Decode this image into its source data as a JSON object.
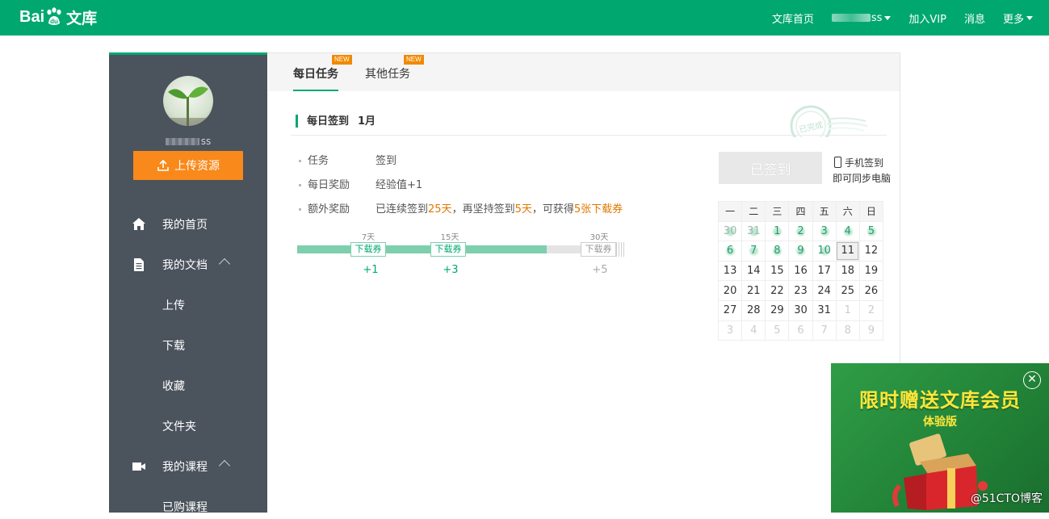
{
  "topbar": {
    "logo_text_en": "Bai",
    "logo_text_du": "du",
    "logo_text_cn": "文库",
    "nav": [
      {
        "label": "文库首页"
      },
      {
        "label": "ss"
      },
      {
        "label": "加入VIP"
      },
      {
        "label": "消息"
      },
      {
        "label": "更多"
      }
    ],
    "accent": "#00a870"
  },
  "sidebar": {
    "username_suffix": "ss",
    "upload_label": "上传资源",
    "items": [
      {
        "label": "我的首页"
      },
      {
        "label": "我的文档"
      },
      {
        "label": "上传"
      },
      {
        "label": "下载"
      },
      {
        "label": "收藏"
      },
      {
        "label": "文件夹"
      },
      {
        "label": "我的课程"
      },
      {
        "label": "已购课程"
      }
    ]
  },
  "tabs": [
    {
      "label": "每日任务",
      "badge": "NEW"
    },
    {
      "label": "其他任务",
      "badge": "NEW"
    }
  ],
  "section": {
    "title": "每日签到",
    "month": "1月",
    "stamp_text": "已完成"
  },
  "task": {
    "rows": [
      {
        "key": "任务",
        "value": "签到"
      },
      {
        "key": "每日奖励",
        "value": "经验值+1"
      },
      {
        "key": "额外奖励",
        "value_parts": [
          "已连续签到",
          "25天",
          "，再坚持签到",
          "5天",
          "，可获得",
          "5张下载券"
        ]
      }
    ],
    "progress": {
      "fill_fraction": 0.76,
      "milestones": [
        {
          "day": "7天",
          "coupon": "下载券",
          "plus": "+1"
        },
        {
          "day": "15天",
          "coupon": "下载券",
          "plus": "+3"
        },
        {
          "day": "30天",
          "coupon": "下载券",
          "plus": "+5"
        }
      ]
    }
  },
  "sign": {
    "button_label": "已签到",
    "mobile_line1": "手机签到",
    "mobile_line2": "即可同步电脑"
  },
  "calendar": {
    "weekdays": [
      "一",
      "二",
      "三",
      "四",
      "五",
      "六",
      "日"
    ],
    "weeks": [
      [
        "30",
        "31",
        "1",
        "2",
        "3",
        "4",
        "5"
      ],
      [
        "6",
        "7",
        "8",
        "9",
        "10",
        "11",
        "12"
      ],
      [
        "13",
        "14",
        "15",
        "16",
        "17",
        "18",
        "19"
      ],
      [
        "20",
        "21",
        "22",
        "23",
        "24",
        "25",
        "26"
      ],
      [
        "27",
        "28",
        "29",
        "30",
        "31",
        "1",
        "2"
      ],
      [
        "3",
        "4",
        "5",
        "6",
        "7",
        "8",
        "9"
      ]
    ],
    "today": "11"
  },
  "promo": {
    "title": "限时赠送文库会员",
    "subtitle": "体验版",
    "close": "✕",
    "watermark": "@51CTO博客"
  }
}
